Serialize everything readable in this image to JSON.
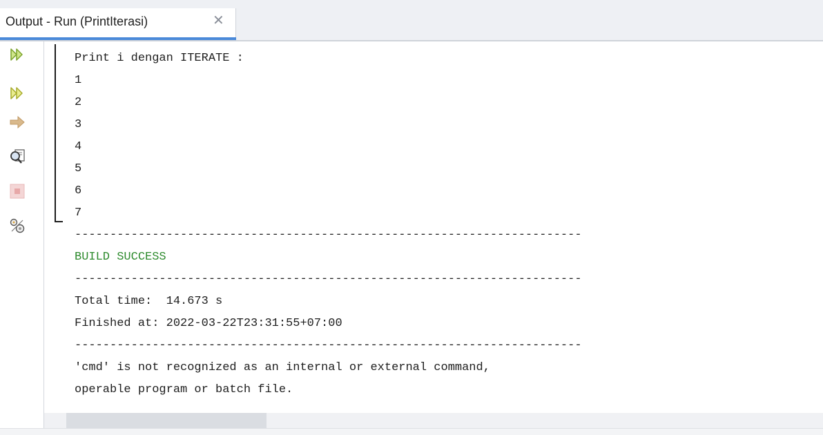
{
  "tab": {
    "label": "Output - Run (PrintIterasi)",
    "close_glyph": "✕"
  },
  "toolbar": {
    "items": [
      {
        "icon": "rerun-icon"
      },
      {
        "icon": "rerun-with-goals-icon"
      },
      {
        "icon": "resume-arrow-icon"
      },
      {
        "icon": "inspect-icon"
      },
      {
        "icon": "stop-icon"
      },
      {
        "icon": "settings-icon"
      }
    ]
  },
  "console": {
    "lines": [
      "Print i dengan ITERATE :",
      "1",
      "2",
      "3",
      "4",
      "5",
      "6",
      "7",
      "------------------------------------------------------------------------",
      "BUILD SUCCESS",
      "------------------------------------------------------------------------",
      "Total time:  14.673 s",
      "Finished at: 2022-03-22T23:31:55+07:00",
      "------------------------------------------------------------------------",
      "'cmd' is not recognized as an internal or external command,",
      "operable program or batch file."
    ]
  },
  "colors": {
    "success": "#2e8b2e",
    "tab_accent": "#4a89d9",
    "rerun_icon": "#8bb832"
  }
}
